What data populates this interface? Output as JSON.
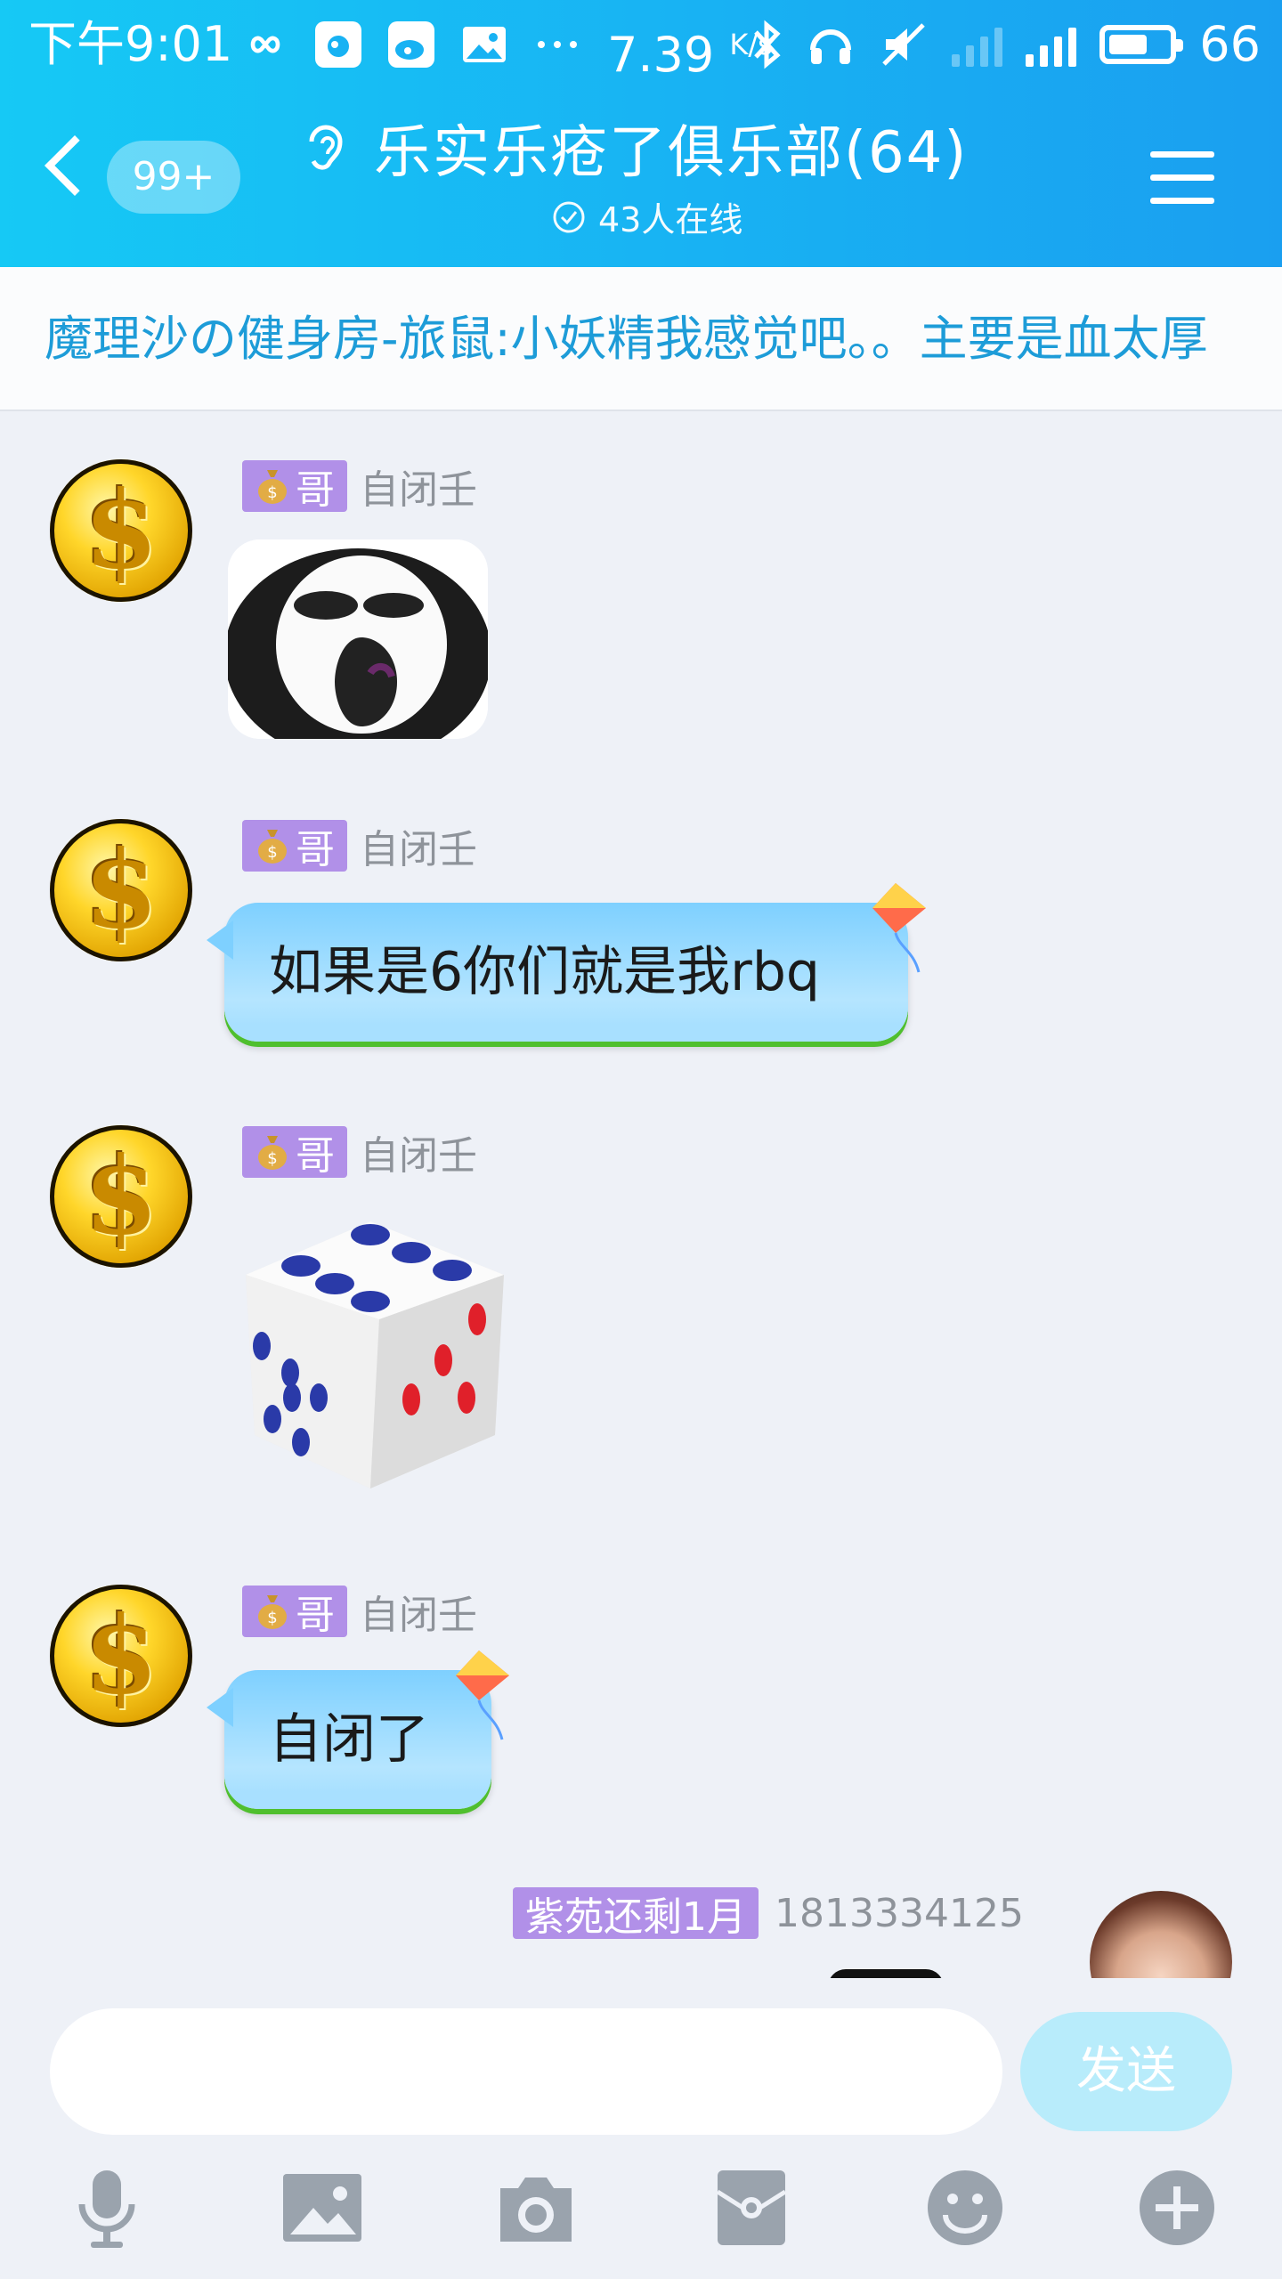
{
  "status_bar": {
    "time": "下午9:01",
    "net_speed": "7.39",
    "net_unit": "K/s",
    "battery": "66",
    "battery_level": 0.66
  },
  "header": {
    "unread_badge": "99+",
    "title": "乐实乐疮了俱乐部(64)",
    "online": "43人在线"
  },
  "notice": {
    "text": "魔理沙の健身房-旅鼠:小妖精我感觉吧。。主要是血太厚"
  },
  "messages": [
    {
      "tag": "哥",
      "sender": "自闭壬",
      "type": "image"
    },
    {
      "tag": "哥",
      "sender": "自闭壬",
      "type": "text",
      "text": "如果是6你们就是我rbq"
    },
    {
      "tag": "哥",
      "sender": "自闭壬",
      "type": "dice"
    },
    {
      "tag": "哥",
      "sender": "自闭壬",
      "type": "text",
      "text": "自闭了"
    },
    {
      "tag": "紫苑还剩1月",
      "sender": "1813334125",
      "type": "image",
      "side": "right"
    }
  ],
  "input": {
    "value": "",
    "send_label": "发送"
  },
  "toolbar": {
    "icons": [
      "microphone-icon",
      "image-icon",
      "camera-icon",
      "red-packet-icon",
      "emoji-icon",
      "plus-icon"
    ]
  },
  "colors": {
    "header": "#18b2f3",
    "notice_text": "#1d9cd8",
    "tag": "#b190e8",
    "bubble": "#7ed0ff",
    "send_button": "#b8ecfb"
  }
}
